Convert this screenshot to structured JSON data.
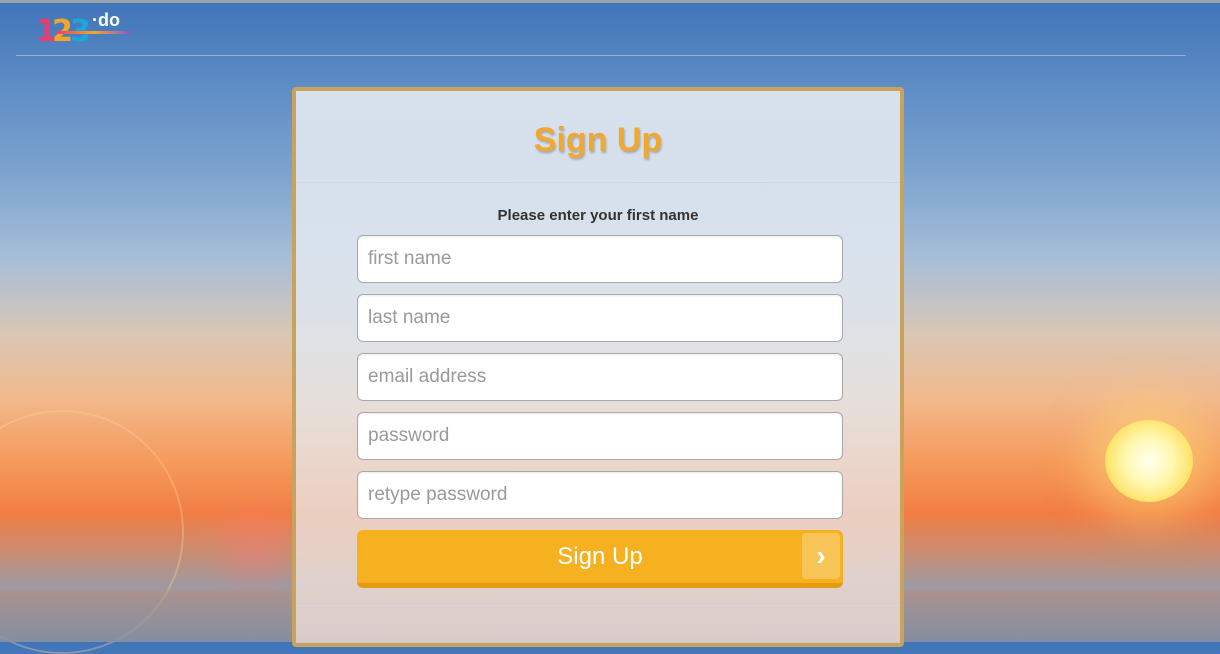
{
  "logo": {
    "d1": "1",
    "d2": "2",
    "d3": "3",
    "suffix": "·do"
  },
  "form": {
    "title": "Sign Up",
    "prompt": "Please enter your first name",
    "fields": [
      {
        "placeholder": "first name",
        "value": ""
      },
      {
        "placeholder": "last name",
        "value": ""
      },
      {
        "placeholder": "email address",
        "value": ""
      },
      {
        "placeholder": "password",
        "value": ""
      },
      {
        "placeholder": "retype password",
        "value": ""
      }
    ],
    "submit_label": "Sign Up",
    "submit_icon": "chevron-right-icon",
    "submit_arrow": "›"
  },
  "colors": {
    "accent": "#f5b120",
    "title": "#f0a830",
    "card_border": "#c9a35c"
  }
}
